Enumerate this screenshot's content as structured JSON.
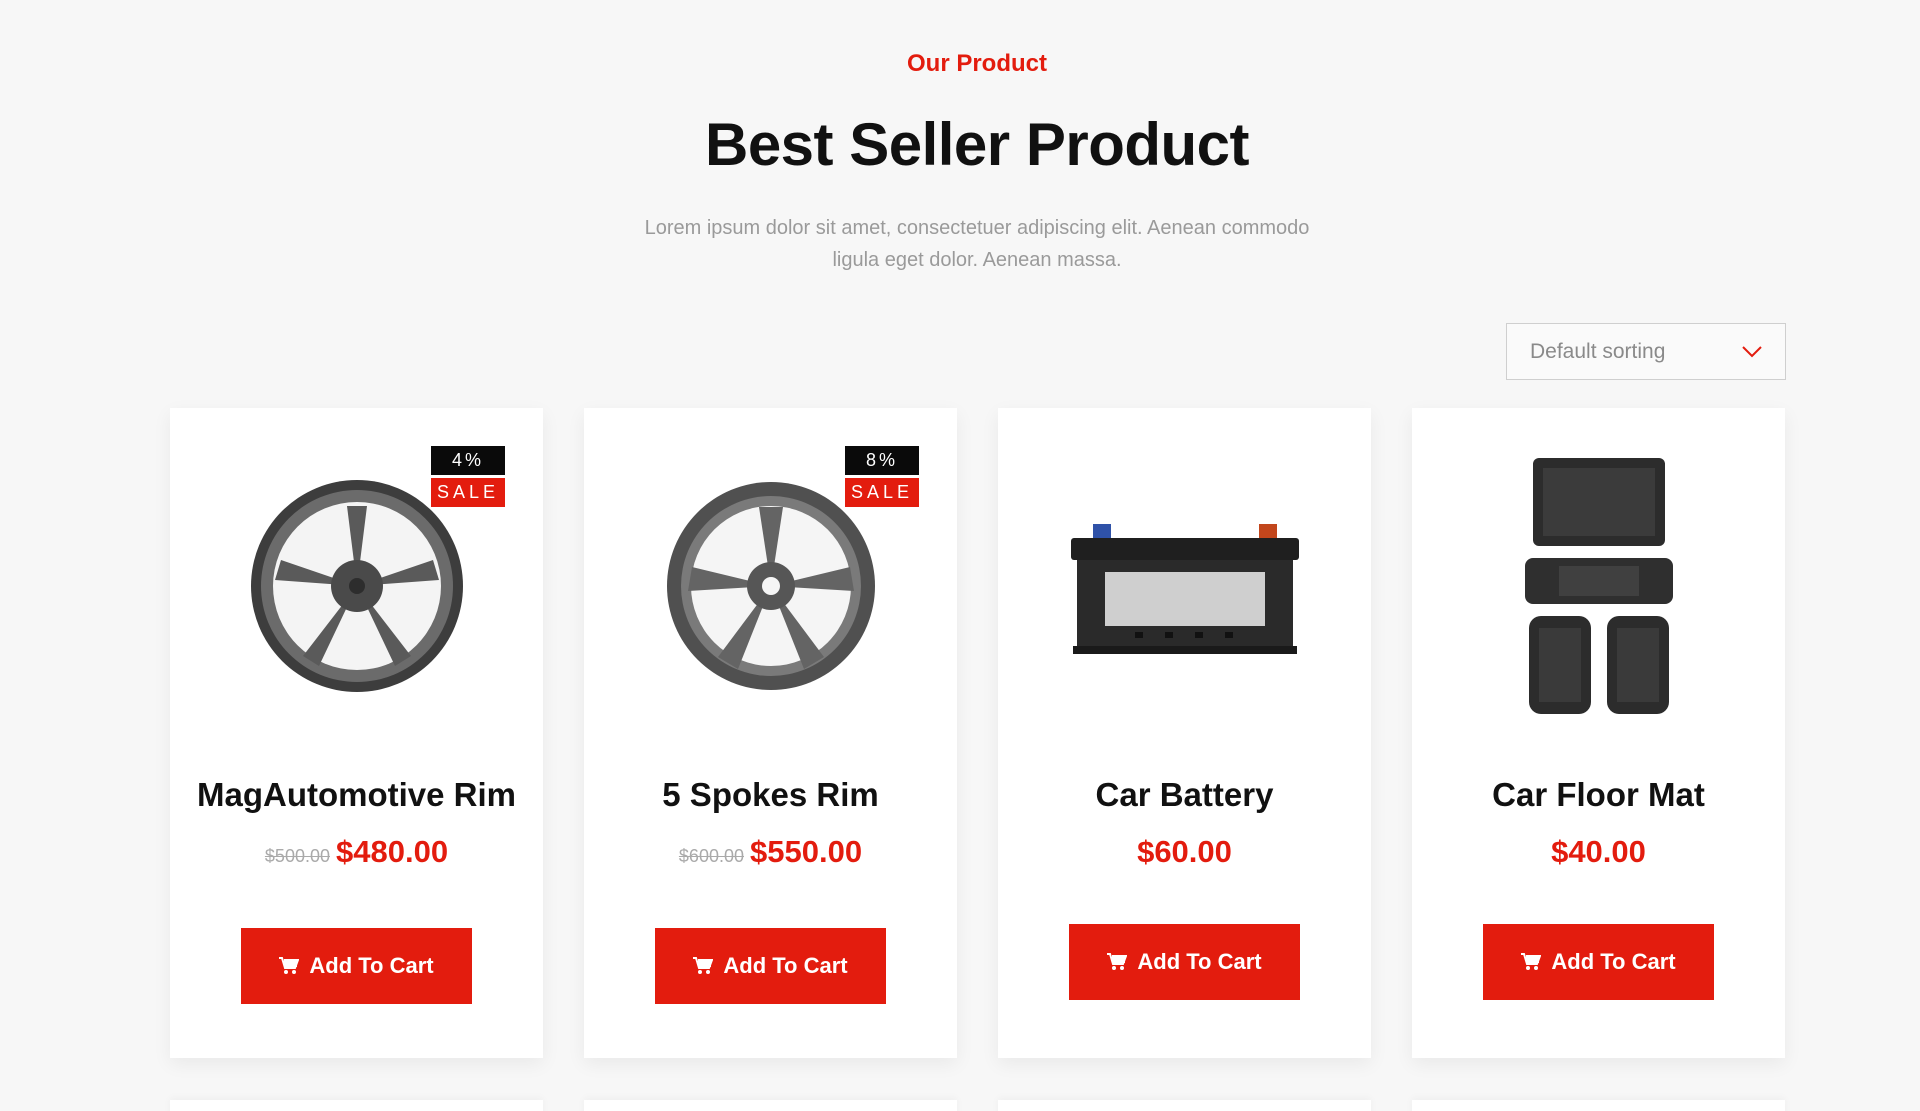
{
  "header": {
    "eyebrow": "Our Product",
    "title": "Best Seller Product",
    "subtitle": "Lorem ipsum dolor sit amet, consectetuer adipiscing elit. Aenean commodo ligula eget dolor. Aenean massa."
  },
  "sort": {
    "selected": "Default sorting",
    "icon": "chevron-down-icon"
  },
  "colors": {
    "accent": "#e31c0e",
    "badge_dark": "#0a0a0a",
    "background": "#f7f7f7"
  },
  "products": [
    {
      "name": "MagAutomotive Rim",
      "image": "rim-icon",
      "badge_pct": "4%",
      "badge_sale": "SALE",
      "old_price": "$500.00",
      "price": "$480.00",
      "button": "Add To Cart"
    },
    {
      "name": "5 Spokes Rim",
      "image": "rim-icon",
      "badge_pct": "8%",
      "badge_sale": "SALE",
      "old_price": "$600.00",
      "price": "$550.00",
      "button": "Add To Cart"
    },
    {
      "name": "Car Battery",
      "image": "battery-icon",
      "price": "$60.00",
      "button": "Add To Cart"
    },
    {
      "name": "Car Floor Mat",
      "image": "floor-mat-icon",
      "price": "$40.00",
      "button": "Add To Cart"
    }
  ]
}
